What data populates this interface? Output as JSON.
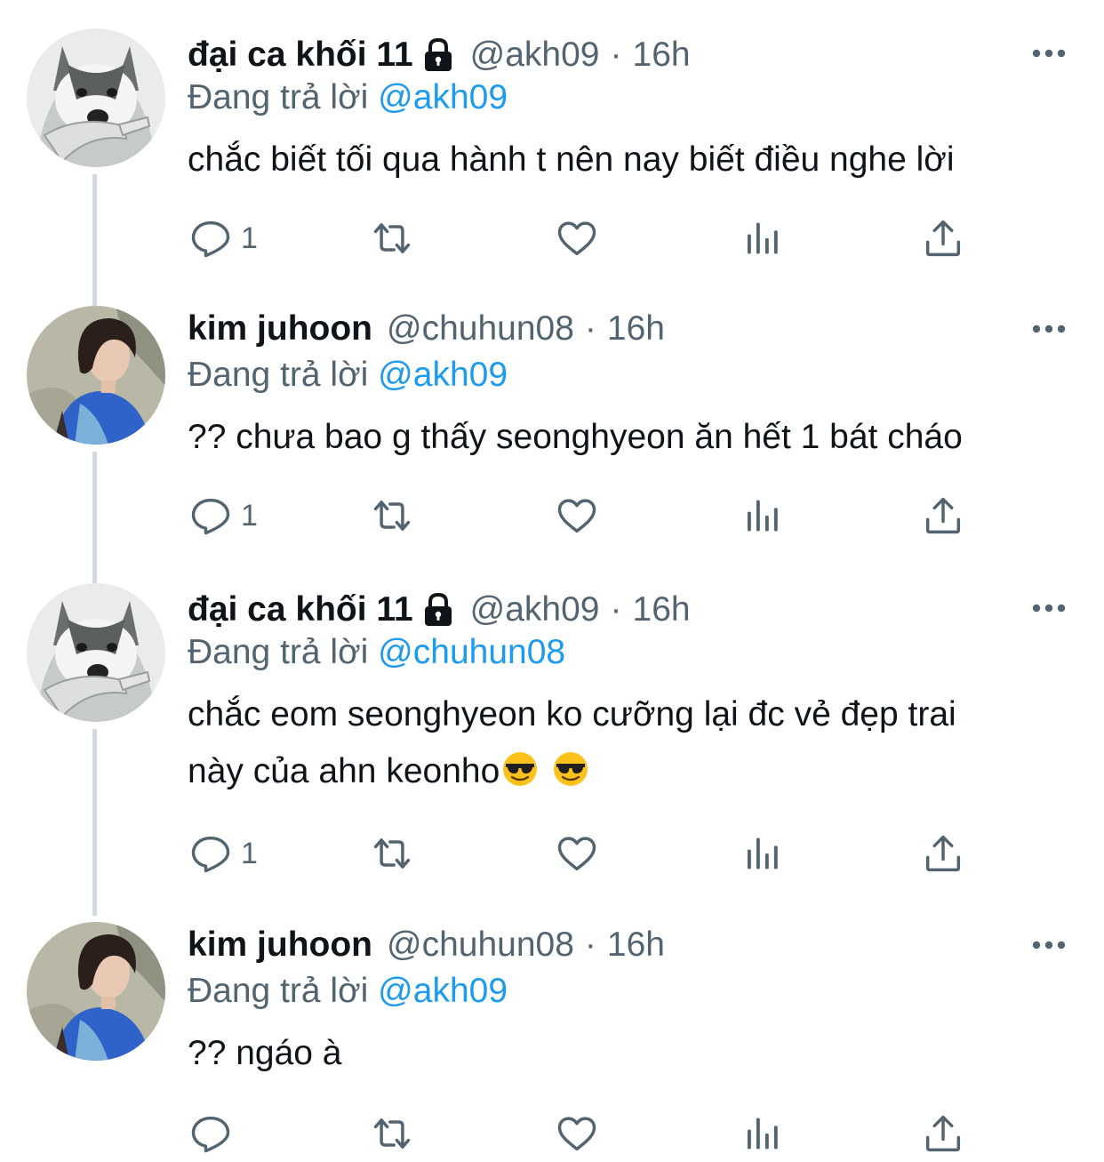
{
  "tweets": [
    {
      "name": "đại ca khối 11",
      "handle": "@akh09",
      "time": "16h",
      "replying_label": "Đang trả lời",
      "replying_to": "@akh09",
      "text": "chắc biết tối qua hành t nên nay biết điều nghe lời",
      "reply_count": "1"
    },
    {
      "name": "kim juhoon",
      "handle": "@chuhun08",
      "time": "16h",
      "replying_label": "Đang trả lời",
      "replying_to": "@akh09",
      "text": "?? chưa bao g thấy seonghyeon ăn hết 1 bát cháo",
      "reply_count": "1"
    },
    {
      "name": "đại ca khối 11",
      "handle": "@akh09",
      "time": "16h",
      "replying_label": "Đang trả lời",
      "replying_to": "@chuhun08",
      "text_line1": "chắc eom seonghyeon ko cưỡng lại đc vẻ đẹp trai",
      "text_line2": "này của ahn keonho",
      "reply_count": "1"
    },
    {
      "name": "kim juhoon",
      "handle": "@chuhun08",
      "time": "16h",
      "replying_label": "Đang trả lời",
      "replying_to": "@akh09",
      "text": "?? ngáo à",
      "reply_count": ""
    }
  ],
  "separator": "·",
  "icons": {
    "lock": "lock-icon",
    "more": "more-icon",
    "reply": "reply-icon",
    "retweet": "retweet-icon",
    "like": "like-icon",
    "views": "views-icon",
    "share": "share-icon",
    "emoji": "sunglasses-emoji"
  },
  "colors": {
    "text": "#0f1419",
    "secondary": "#536471",
    "link": "#1d9bf0",
    "thread_line": "#cfd9de"
  }
}
